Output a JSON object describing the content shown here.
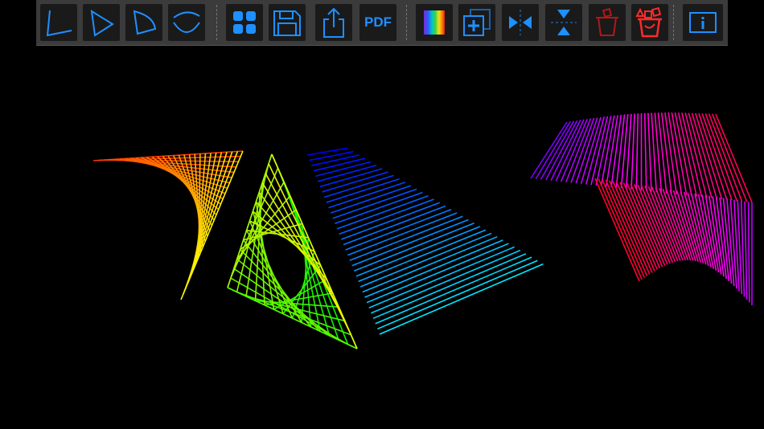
{
  "toolbar": {
    "buttons": [
      {
        "name": "angle-tool-button",
        "icon": "angle-icon"
      },
      {
        "name": "triangle-tool-button",
        "icon": "triangle-icon"
      },
      {
        "name": "sector-tool-button",
        "icon": "sector-icon"
      },
      {
        "name": "curve-tool-button",
        "icon": "curve-icon"
      },
      {
        "name": "gallery-button",
        "icon": "grid-icon"
      },
      {
        "name": "save-button",
        "icon": "floppy-disk-icon"
      },
      {
        "name": "share-button",
        "icon": "share-icon"
      },
      {
        "name": "pdf-export-button",
        "icon": "pdf-text"
      },
      {
        "name": "color-palette-button",
        "icon": "rainbow-icon"
      },
      {
        "name": "duplicate-button",
        "icon": "duplicate-icon"
      },
      {
        "name": "mirror-horizontal-button",
        "icon": "mirror-horizontal-icon"
      },
      {
        "name": "mirror-vertical-button",
        "icon": "mirror-vertical-icon"
      },
      {
        "name": "delete-selected-button",
        "icon": "trash-icon"
      },
      {
        "name": "delete-all-button",
        "icon": "trash-all-icon"
      },
      {
        "name": "info-button",
        "icon": "info-icon"
      }
    ],
    "pdf_label": "PDF"
  },
  "colors": {
    "icon_blue": "#1e90ff",
    "icon_dark_blue": "#1a5fa8",
    "icon_red": "#ff2a2a",
    "icon_dark_red": "#b01818",
    "toolbar_bg": "#3b3b3b",
    "button_bg": "#1a1a1a",
    "canvas_bg": "#000000"
  }
}
